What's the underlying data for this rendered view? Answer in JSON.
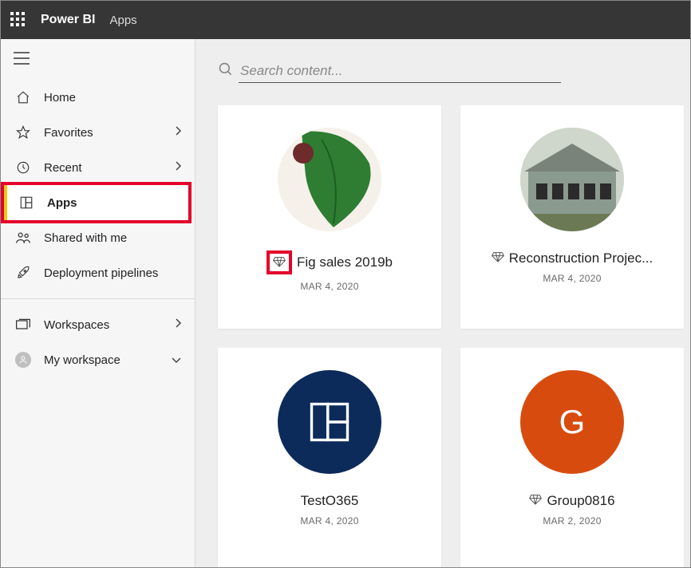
{
  "header": {
    "brand": "Power BI",
    "crumb": "Apps"
  },
  "search": {
    "placeholder": "Search content..."
  },
  "nav": {
    "home": "Home",
    "favorites": "Favorites",
    "recent": "Recent",
    "apps": "Apps",
    "shared": "Shared with me",
    "pipelines": "Deployment pipelines",
    "workspaces": "Workspaces",
    "myworkspace": "My workspace"
  },
  "cards": [
    {
      "title": "Fig sales 2019b",
      "date": "MAR 4, 2020",
      "premium": true
    },
    {
      "title": "Reconstruction Projec...",
      "date": "MAR 4, 2020",
      "premium": true
    },
    {
      "title": "TestO365",
      "date": "MAR 4, 2020",
      "premium": false,
      "letter": ""
    },
    {
      "title": "Group0816",
      "date": "MAR 2, 2020",
      "premium": true,
      "letter": "G"
    }
  ]
}
